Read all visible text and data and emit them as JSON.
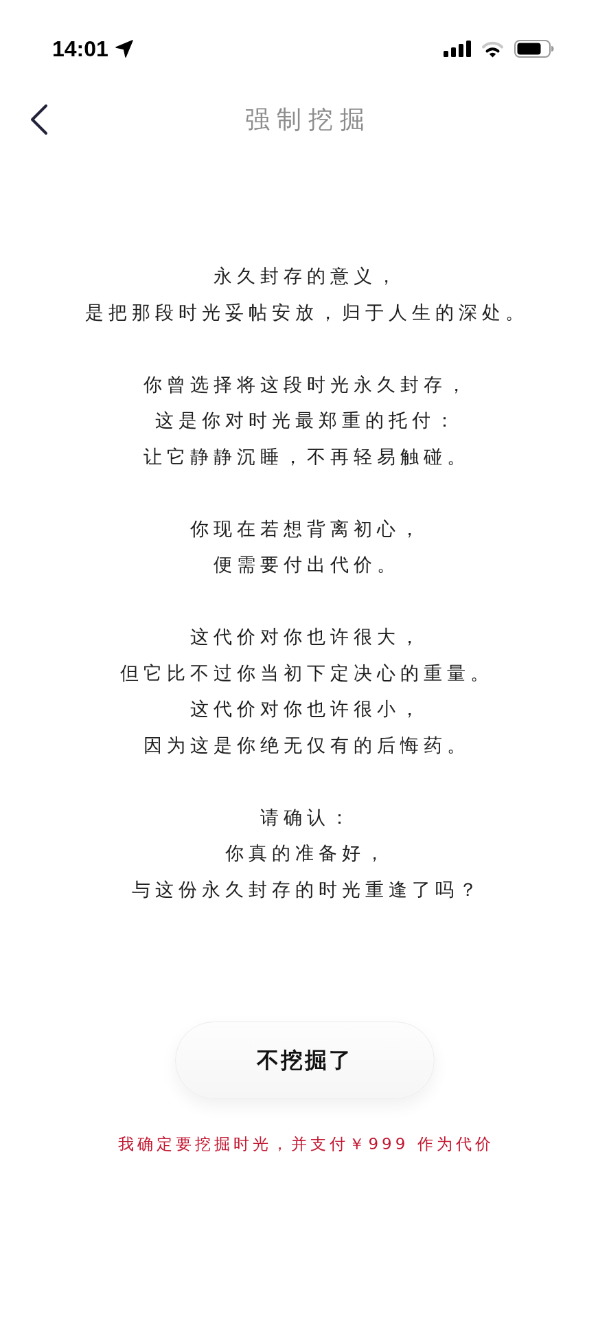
{
  "status_bar": {
    "time": "14:01"
  },
  "nav_bar": {
    "title": "强制挖掘"
  },
  "message": {
    "paragraphs": [
      [
        "永久封存的意义，",
        "是把那段时光妥帖安放，归于人生的深处。"
      ],
      [
        "你曾选择将这段时光永久封存，",
        "这是你对时光最郑重的托付：",
        "让它静静沉睡，不再轻易触碰。"
      ],
      [
        "你现在若想背离初心，",
        "便需要付出代价。"
      ],
      [
        "这代价对你也许很大，",
        "但它比不过你当初下定决心的重量。",
        "这代价对你也许很小，",
        "因为这是你绝无仅有的后悔药。"
      ],
      [
        "请确认：",
        "你真的准备好，",
        "与这份永久封存的时光重逢了吗？"
      ]
    ]
  },
  "actions": {
    "cancel_button": {
      "label": "不挖掘了"
    },
    "confirm_link": {
      "label": "我确定要挖掘时光，并支付￥999 作为代价"
    }
  }
}
